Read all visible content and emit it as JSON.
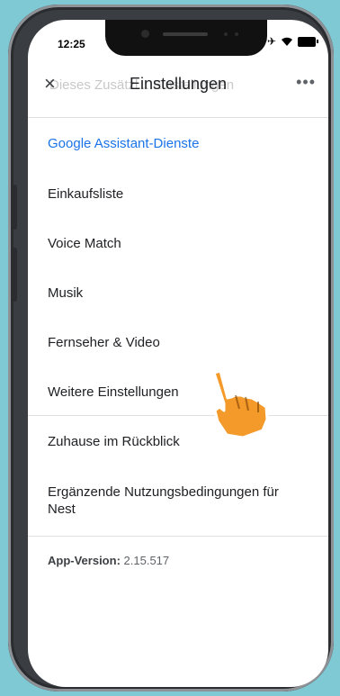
{
  "status_bar": {
    "time": "12:25"
  },
  "header": {
    "title": "Einstellungen",
    "ghost_text": "Dieses Zusätzl... Einstellungen",
    "close_symbol": "×",
    "more_symbol": "•••"
  },
  "section": {
    "title": "Google Assistant-Dienste"
  },
  "items": [
    {
      "label": "Einkaufsliste"
    },
    {
      "label": "Voice Match"
    },
    {
      "label": "Musik"
    },
    {
      "label": "Fernseher & Video"
    },
    {
      "label": "Weitere Einstellungen"
    },
    {
      "label": "Zuhause im Rückblick"
    },
    {
      "label": "Ergänzende Nutzungsbedingungen für Nest"
    }
  ],
  "version": {
    "label": "App-Version:",
    "value": "2.15.517"
  },
  "colors": {
    "accent": "#1a73e8",
    "background": "#7ec9d3",
    "hand": "#f39a2a"
  },
  "icons": [
    "close-icon",
    "more-icon",
    "airplane-icon",
    "wifi-icon",
    "battery-icon",
    "pointer-hand-icon"
  ]
}
